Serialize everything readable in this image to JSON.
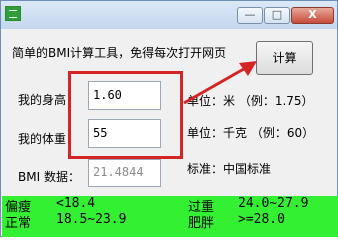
{
  "titlebar": {
    "minimize": "—",
    "maximize": "□",
    "close": "X"
  },
  "header_text": "简单的BMI计算工具，免得每次打开网页",
  "calc_button": "计算",
  "height": {
    "label": "我的身高：",
    "value": "1.60",
    "unit": "单位：米 （例：1.75）"
  },
  "weight": {
    "label": "我的体重：",
    "value": "55",
    "unit": "单位：千克 （例：60）"
  },
  "bmi": {
    "label": "BMI 数据：",
    "value": "21.4844"
  },
  "standard": "标准：中国标准",
  "categories": [
    {
      "name": "偏瘦",
      "range": "<18.4"
    },
    {
      "name": "正常",
      "range": "18.5~23.9"
    },
    {
      "name": "过重",
      "range": "24.0~27.9"
    },
    {
      "name": "肥胖",
      "range": ">=28.0"
    }
  ],
  "colors": {
    "annotation_red": "#d42424",
    "legend_green": "#33f033"
  }
}
